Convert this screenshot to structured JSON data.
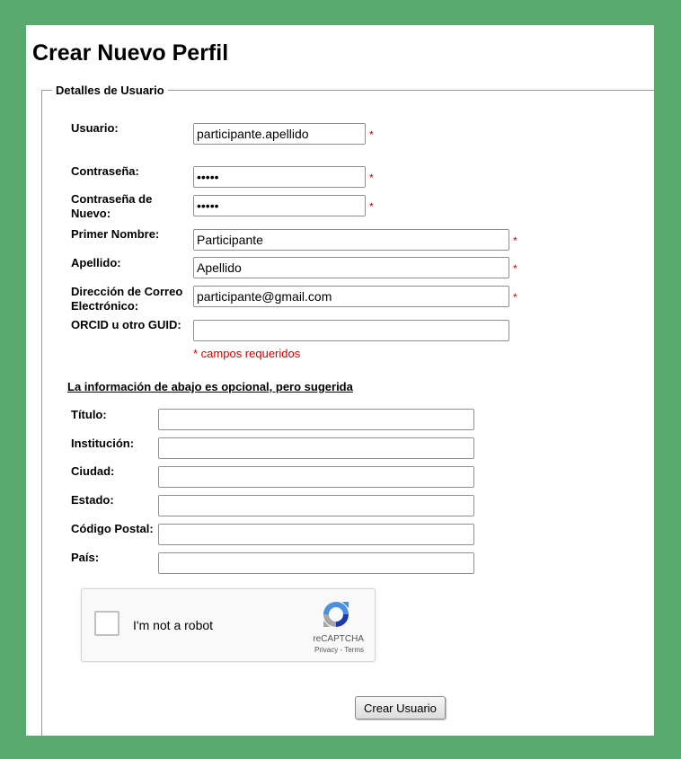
{
  "page": {
    "title": "Crear Nuevo Perfil",
    "background": "#5aa96e"
  },
  "user_details": {
    "legend": "Detalles de Usuario",
    "username": {
      "label": "Usuario:",
      "value": "participante.apellido",
      "required_mark": "*"
    },
    "password": {
      "label": "Contraseña:",
      "value": "•••••",
      "required_mark": "*"
    },
    "password_repeat": {
      "label_line1": "Contraseña de",
      "label_line2": "Nuevo:",
      "value": "•••••",
      "required_mark": "*"
    },
    "first_name": {
      "label": "Primer Nombre:",
      "value": "Participante",
      "required_mark": "*"
    },
    "last_name": {
      "label": "Apellido:",
      "value": "Apellido",
      "required_mark": "*"
    },
    "email": {
      "label_line1": "Dirección de Correo",
      "label_line2": "Electrónico:",
      "value": "participante@gmail.com",
      "required_mark": "*"
    },
    "orcid": {
      "label": "ORCID u otro GUID:",
      "value": ""
    },
    "required_note": "* campos requeridos"
  },
  "optional": {
    "heading": "La información de abajo es opcional, pero sugerida",
    "title": {
      "label": "Título:",
      "value": ""
    },
    "institution": {
      "label": "Institución:",
      "value": ""
    },
    "city": {
      "label": "Ciudad:",
      "value": ""
    },
    "state": {
      "label": "Estado:",
      "value": ""
    },
    "postal_code": {
      "label": "Código Postal:",
      "value": ""
    },
    "country": {
      "label": "País:",
      "value": ""
    }
  },
  "captcha": {
    "label": "I'm not a robot",
    "brand": "reCAPTCHA",
    "privacy": "Privacy",
    "separator": " - ",
    "terms": "Terms",
    "icon": "recaptcha-logo"
  },
  "submit": {
    "label": "Crear Usuario"
  },
  "colors": {
    "required": "#cc0000",
    "accent": "#5aa96e"
  }
}
